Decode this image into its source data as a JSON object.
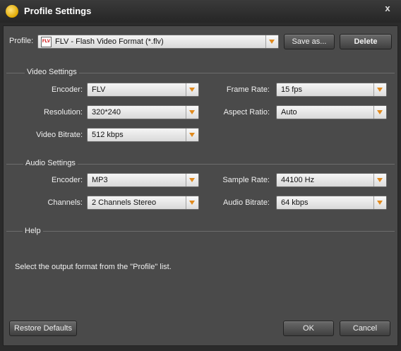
{
  "window": {
    "title": "Profile Settings",
    "close_symbol": "x"
  },
  "profile": {
    "label": "Profile:",
    "value": "FLV - Flash Video Format (*.flv)",
    "icon_text": "FLV",
    "save_as_label": "Save as...",
    "delete_label": "Delete"
  },
  "video": {
    "title": "Video Settings",
    "encoder": {
      "label": "Encoder:",
      "value": "FLV"
    },
    "frame_rate": {
      "label": "Frame Rate:",
      "value": "15 fps"
    },
    "resolution": {
      "label": "Resolution:",
      "value": "320*240"
    },
    "aspect_ratio": {
      "label": "Aspect Ratio:",
      "value": "Auto"
    },
    "bitrate": {
      "label": "Video Bitrate:",
      "value": "512 kbps"
    }
  },
  "audio": {
    "title": "Audio Settings",
    "encoder": {
      "label": "Encoder:",
      "value": "MP3"
    },
    "sample_rate": {
      "label": "Sample Rate:",
      "value": "44100 Hz"
    },
    "channels": {
      "label": "Channels:",
      "value": "2 Channels Stereo"
    },
    "bitrate": {
      "label": "Audio Bitrate:",
      "value": "64 kbps"
    }
  },
  "help": {
    "title": "Help",
    "text": "Select the output format from the \"Profile\" list."
  },
  "buttons": {
    "restore": "Restore Defaults",
    "ok": "OK",
    "cancel": "Cancel"
  },
  "colors": {
    "accent_arrow": "#e08a1e",
    "panel": "#4a4a4a",
    "titlebar": "#2b2b2b"
  }
}
